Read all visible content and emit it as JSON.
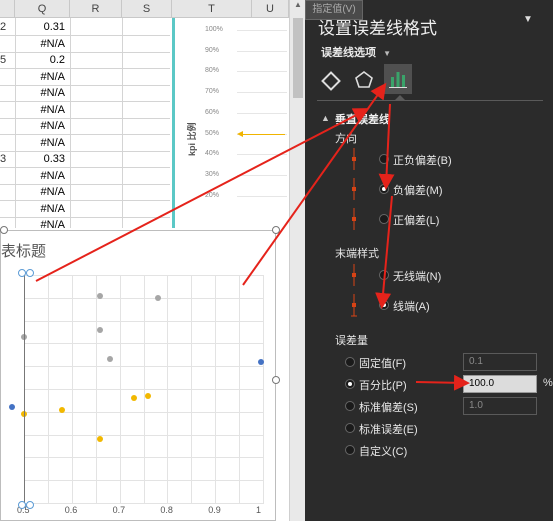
{
  "sheet": {
    "columns": [
      "Q",
      "R",
      "S",
      "T",
      "U"
    ],
    "rows": [
      {
        "rownum": "2",
        "q": "0.31"
      },
      {
        "rownum": "",
        "q": "#N/A"
      },
      {
        "rownum": "5",
        "q": "0.2"
      },
      {
        "rownum": "",
        "q": "#N/A"
      },
      {
        "rownum": "",
        "q": "#N/A"
      },
      {
        "rownum": "",
        "q": "#N/A"
      },
      {
        "rownum": "",
        "q": "#N/A"
      },
      {
        "rownum": "",
        "q": "#N/A"
      },
      {
        "rownum": "3",
        "q": "0.33"
      },
      {
        "rownum": "",
        "q": "#N/A"
      },
      {
        "rownum": "",
        "q": "#N/A"
      },
      {
        "rownum": "",
        "q": "#N/A"
      },
      {
        "rownum": "",
        "q": "#N/A"
      }
    ]
  },
  "chart_data": [
    {
      "type": "line",
      "ylabel": "kpi 比例",
      "ytick_labels": [
        "100%",
        "90%",
        "80%",
        "70%",
        "60%",
        "50%",
        "40%",
        "30%",
        "20%"
      ],
      "ylim": [
        0.2,
        1.0
      ],
      "annotation_level": 0.5,
      "accent": "#f0b400"
    },
    {
      "type": "scatter",
      "title": "表标题",
      "xtick_labels": [
        "0.5",
        "0.6",
        "0.7",
        "0.8",
        "0.9",
        "1"
      ],
      "xlim": [
        0.5,
        1.0
      ],
      "ylim": [
        0,
        10
      ],
      "series": [
        {
          "color": "#a6a6a6",
          "points": [
            [
              0.66,
              9.1
            ],
            [
              0.78,
              9.0
            ],
            [
              0.66,
              7.6
            ],
            [
              0.68,
              6.3
            ],
            [
              0.5,
              7.3
            ]
          ]
        },
        {
          "color": "#f2b800",
          "points": [
            [
              0.5,
              3.9
            ],
            [
              0.58,
              4.1
            ],
            [
              0.73,
              4.6
            ],
            [
              0.76,
              4.7
            ],
            [
              0.66,
              2.8
            ]
          ]
        },
        {
          "color": "#4472c4",
          "points": [
            [
              0.475,
              4.2
            ],
            [
              0.995,
              6.2
            ]
          ]
        }
      ],
      "error_bar_x": 0.5
    }
  ],
  "pane": {
    "title": "设置误差线格式",
    "options_dropdown": "误差线选项",
    "section": "垂直误差线",
    "direction_title": "方向",
    "direction": [
      {
        "label": "正负偏差(B)",
        "selected": false
      },
      {
        "label": "负偏差(M)",
        "selected": true
      },
      {
        "label": "正偏差(L)",
        "selected": false
      }
    ],
    "endstyle_title": "末端样式",
    "endstyle": [
      {
        "label": "无线端(N)",
        "selected": false
      },
      {
        "label": "线端(A)",
        "selected": true
      }
    ],
    "amount_title": "误差量",
    "amount": [
      {
        "label": "固定值(F)",
        "selected": false,
        "value": "0.1"
      },
      {
        "label": "百分比(P)",
        "selected": true,
        "value": "100.0",
        "unit": "%"
      },
      {
        "label": "标准偏差(S)",
        "selected": false,
        "value": "1.0"
      },
      {
        "label": "标准误差(E)",
        "selected": false
      },
      {
        "label": "自定义(C)",
        "selected": false,
        "button": "指定值(V)"
      }
    ],
    "accent_color": "#d84315",
    "arrow_color": "#e5231b"
  }
}
